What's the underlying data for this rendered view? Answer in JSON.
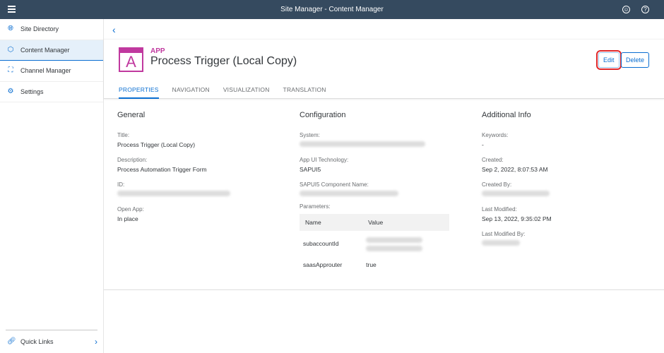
{
  "shell": {
    "title": "Site Manager - Content Manager",
    "menu_icon": "hamburger-icon",
    "user_icon": "user-icon",
    "help_icon": "help-icon"
  },
  "sidebar": {
    "items": [
      {
        "label": "Site Directory",
        "icon": "globe-icon"
      },
      {
        "label": "Content Manager",
        "icon": "content-icon",
        "selected": true
      },
      {
        "label": "Channel Manager",
        "icon": "hierarchy-icon"
      },
      {
        "label": "Settings",
        "icon": "settings-icon"
      }
    ],
    "quick_links": "Quick Links"
  },
  "header": {
    "type": "APP",
    "icon_letter": "A",
    "title": "Process Trigger (Local Copy)",
    "edit": "Edit",
    "delete": "Delete"
  },
  "tabs": [
    "PROPERTIES",
    "NAVIGATION",
    "VISUALIZATION",
    "TRANSLATION"
  ],
  "general": {
    "heading": "General",
    "title_label": "Title:",
    "title": "Process Trigger (Local Copy)",
    "desc_label": "Description:",
    "desc": "Process Automation Trigger Form",
    "id_label": "ID:",
    "open_label": "Open App:",
    "open": "In place"
  },
  "config": {
    "heading": "Configuration",
    "system_label": "System:",
    "tech_label": "App UI Technology:",
    "tech": "SAPUI5",
    "comp_label": "SAPUI5 Component Name:",
    "params_label": "Parameters:",
    "col_name": "Name",
    "col_value": "Value",
    "params": [
      {
        "name": "subaccountId"
      },
      {
        "name": "saasApprouter",
        "value": "true"
      }
    ]
  },
  "info": {
    "heading": "Additional Info",
    "keywords_label": "Keywords:",
    "keywords": "-",
    "created_label": "Created:",
    "created": "Sep 2, 2022, 8:07:53 AM",
    "created_by_label": "Created By:",
    "modified_label": "Last Modified:",
    "modified": "Sep 13, 2022, 9:35:02 PM",
    "modified_by_label": "Last Modified By:"
  }
}
